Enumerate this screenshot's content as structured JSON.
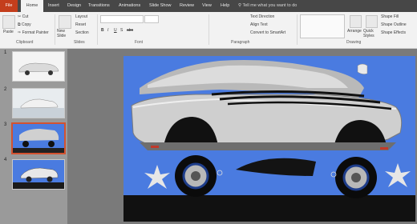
{
  "tabs": {
    "file": "File",
    "home": "Home",
    "insert": "Insert",
    "design": "Design",
    "transitions": "Transitions",
    "animations": "Animations",
    "slideshow": "Slide Show",
    "review": "Review",
    "view": "View",
    "help": "Help"
  },
  "tell_me": "Tell me what you want to do",
  "ribbon": {
    "paste": "Paste",
    "cut": "Cut",
    "copy": "Copy",
    "format_painter": "Format Painter",
    "new_slide": "New Slide",
    "layout": "Layout",
    "reset": "Reset",
    "section": "Section",
    "text_direction": "Text Direction",
    "align_text": "Align Text",
    "convert_smartart": "Convert to SmartArt",
    "arrange": "Arrange",
    "quick_styles": "Quick Styles",
    "shape_fill": "Shape Fill",
    "shape_outline": "Shape Outline",
    "shape_effects": "Shape Effects",
    "bold": "B",
    "italic": "I",
    "underline": "U",
    "strike": "S",
    "abc": "abc"
  },
  "groups": {
    "clipboard": "Clipboard",
    "slides": "Slides",
    "font": "Font",
    "paragraph": "Paragraph",
    "drawing": "Drawing"
  },
  "slides": [
    {
      "number": "1"
    },
    {
      "number": "2"
    },
    {
      "number": "3"
    },
    {
      "number": "4"
    }
  ],
  "colors": {
    "accent": "#c43e1c",
    "slide_background": "#4a7be0",
    "car_body": "#c8c8c8",
    "selection": "#d35230"
  },
  "icons": [
    "paste-icon",
    "cut-icon",
    "copy-icon",
    "format-painter-icon",
    "new-slide-icon",
    "tell-me-icon",
    "shapes-gallery",
    "arrange-icon",
    "quick-styles-icon"
  ]
}
